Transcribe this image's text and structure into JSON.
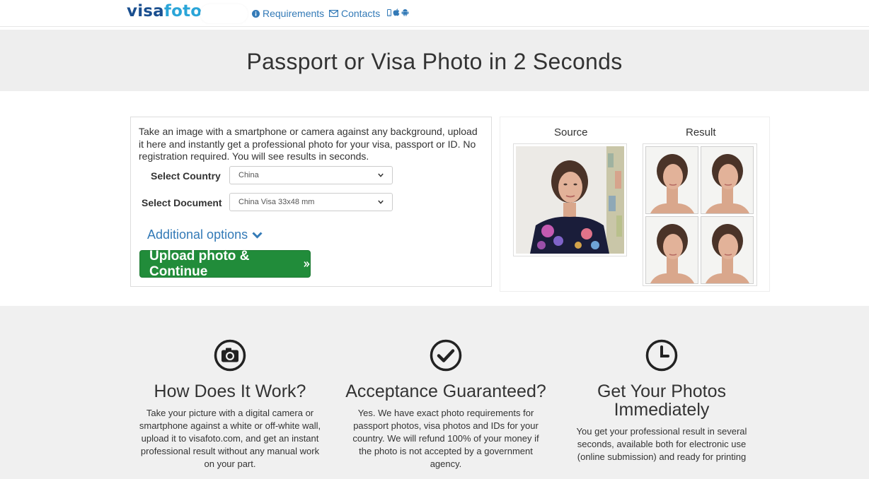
{
  "nav": {
    "logo_visa": "visa",
    "logo_foto": "foto",
    "requirements": "Requirements",
    "contacts": "Contacts",
    "device_icons": [
      "mobile-icon",
      "apple-icon",
      "android-icon"
    ]
  },
  "hero": {
    "title": "Passport or Visa Photo in 2 Seconds"
  },
  "upload": {
    "intro": "Take an image with a smartphone or camera against any background, upload it here and instantly get a professional photo for your visa, passport or ID. No registration required. You will see results in seconds.",
    "country_label": "Select Country",
    "country_value": "China",
    "document_label": "Select Document",
    "document_value": "China Visa 33x48 mm",
    "additional_options": "Additional options",
    "upload_button": "Upload photo & Continue"
  },
  "preview": {
    "source_label": "Source",
    "result_label": "Result"
  },
  "features": [
    {
      "icon": "camera-icon",
      "title": "How Does It Work?",
      "text": "Take your picture with a digital camera or smartphone against a white or off-white wall, upload it to visafoto.com, and get an instant professional result without any manual work on your part."
    },
    {
      "icon": "check-circle-icon",
      "title": "Acceptance Guaranteed?",
      "text": "Yes. We have exact photo requirements for passport photos, visa photos and IDs for your country. We will refund 100% of your money if the photo is not accepted by a government agency."
    },
    {
      "icon": "clock-icon",
      "title": "Get Your Photos Immediately",
      "text": "You get your professional result in several seconds, available both for electronic use (online submission) and ready for printing"
    }
  ],
  "colors": {
    "brand_dark": "#1a4f8f",
    "brand_light": "#2aa5d8",
    "link": "#337ab7",
    "button_green": "#218c3a"
  }
}
